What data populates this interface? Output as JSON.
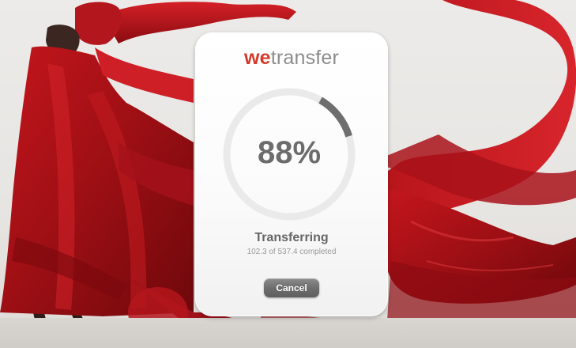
{
  "brand": {
    "logo_we": "we",
    "logo_rest": "transfer",
    "accent_color": "#d43a2c"
  },
  "transfer": {
    "percent_label": "88%",
    "progress_fraction": 0.88,
    "status": "Transferring",
    "detail": "102.3 of 537.4 completed"
  },
  "actions": {
    "cancel_label": "Cancel"
  },
  "background": {
    "description_color": "#b3161c"
  }
}
